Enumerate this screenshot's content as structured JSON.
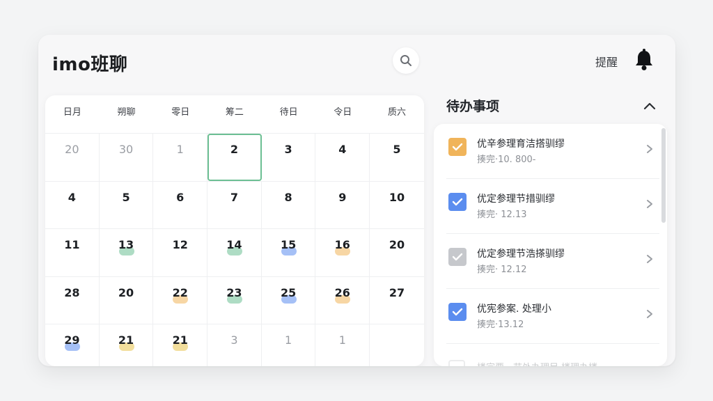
{
  "app": {
    "title": "imo班聊"
  },
  "header": {
    "remind_label": "提醒"
  },
  "icons": {
    "search": "search-icon",
    "bell": "bell-icon",
    "collapse": "chevron-up-icon",
    "chevron": "chevron-right-icon",
    "check": "check-icon"
  },
  "colors": {
    "green": "#6cbf93",
    "blue": "#5b8def",
    "yellow": "#e8c34a",
    "orange": "#f0b45a",
    "gray": "#c6c8cc"
  },
  "calendar": {
    "weekdays": [
      "日月",
      "朔聊",
      "零日",
      "筹二",
      "待日",
      "令日",
      "质六"
    ],
    "weeks": [
      [
        {
          "d": "20",
          "m": true
        },
        {
          "d": "30",
          "m": true
        },
        {
          "d": "1",
          "m": true
        },
        {
          "d": "2",
          "sel": true
        },
        {
          "d": "3"
        },
        {
          "d": "4"
        },
        {
          "d": "5"
        }
      ],
      [
        {
          "d": "4"
        },
        {
          "d": "5"
        },
        {
          "d": "6"
        },
        {
          "d": "7"
        },
        {
          "d": "8"
        },
        {
          "d": "9"
        },
        {
          "d": "10"
        }
      ],
      [
        {
          "d": "11"
        },
        {
          "d": "13",
          "dot": "green"
        },
        {
          "d": "12"
        },
        {
          "d": "14",
          "dot": "green"
        },
        {
          "d": "15",
          "dot": "blue"
        },
        {
          "d": "16",
          "dot": "orange"
        },
        {
          "d": "20"
        }
      ],
      [
        {
          "d": "28"
        },
        {
          "d": "20"
        },
        {
          "d": "22",
          "dot": "orange"
        },
        {
          "d": "23",
          "dot": "green"
        },
        {
          "d": "25",
          "dot": "blue"
        },
        {
          "d": "26",
          "dot": "orange"
        },
        {
          "d": "27"
        }
      ],
      [
        {
          "d": "29",
          "dot": "blue"
        },
        {
          "d": "21",
          "dot": "yellow"
        },
        {
          "d": "21",
          "dot": "yellow"
        },
        {
          "d": "3",
          "m": true
        },
        {
          "d": "1",
          "m": true
        },
        {
          "d": "1",
          "m": true
        },
        {
          "d": ""
        }
      ]
    ]
  },
  "todo": {
    "header": "待办事项",
    "items": [
      {
        "title": "优辛参理育洁搭驯缪",
        "due": "揍完·10. 800-",
        "check": "orange",
        "checked": true
      },
      {
        "title": "优定参理节措驯缪",
        "due": "揍完· 12.13",
        "check": "blue",
        "checked": true
      },
      {
        "title": "优定参理节浩搽驯缪",
        "due": "揍完· 12.12",
        "check": "gray",
        "checked": true
      },
      {
        "title": "优宪参案. 处理小",
        "due": "揍完·13.12",
        "check": "blue",
        "checked": true
      }
    ],
    "partial": "楼宗要一节处办理目 楼理办楼"
  }
}
